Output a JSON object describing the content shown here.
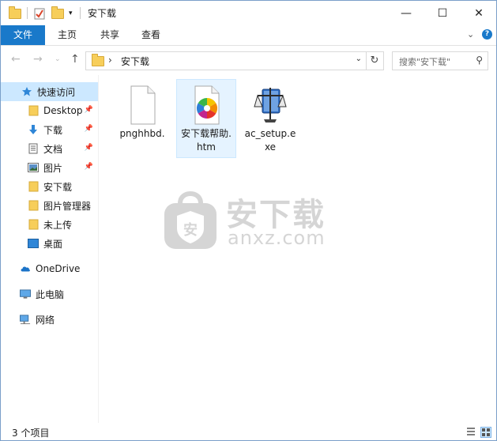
{
  "window": {
    "title": "安下载",
    "controls": {
      "minimize": "—",
      "maximize": "☐",
      "close": "✕"
    }
  },
  "ribbon": {
    "tabs": [
      {
        "label": "文件",
        "active": true
      },
      {
        "label": "主页"
      },
      {
        "label": "共享"
      },
      {
        "label": "查看"
      }
    ]
  },
  "address": {
    "path": "安下载",
    "separator": "›",
    "search_placeholder": "搜索\"安下载\""
  },
  "sidebar": {
    "items": [
      {
        "label": "快速访问",
        "icon": "star-icon",
        "selected": true
      },
      {
        "label": "Desktop",
        "icon": "folder-icon",
        "pinned": true
      },
      {
        "label": "下载",
        "icon": "download-arrow-icon",
        "pinned": true
      },
      {
        "label": "文档",
        "icon": "document-icon",
        "pinned": true
      },
      {
        "label": "图片",
        "icon": "picture-icon",
        "pinned": true
      },
      {
        "label": "安下载",
        "icon": "folder-icon"
      },
      {
        "label": "图片管理器",
        "icon": "folder-icon"
      },
      {
        "label": "未上传",
        "icon": "folder-icon"
      },
      {
        "label": "桌面",
        "icon": "desktop-icon"
      },
      {
        "label": "OneDrive",
        "icon": "cloud-icon"
      },
      {
        "label": "此电脑",
        "icon": "computer-icon"
      },
      {
        "label": "网络",
        "icon": "network-icon"
      }
    ]
  },
  "files": [
    {
      "name": "pnghhbd.",
      "icon": "blank-file-icon"
    },
    {
      "name": "安下载帮助.htm",
      "icon": "htm-file-icon",
      "selected": true
    },
    {
      "name": "ac_setup.exe",
      "icon": "installer-scales-icon"
    }
  ],
  "watermark": {
    "cn": "安下载",
    "en": "anxz.com",
    "badge": "安"
  },
  "status": {
    "count": "3 个项目"
  },
  "colors": {
    "accent": "#1979ca",
    "selection": "#cce8ff",
    "folder": "#f7ce5a"
  }
}
